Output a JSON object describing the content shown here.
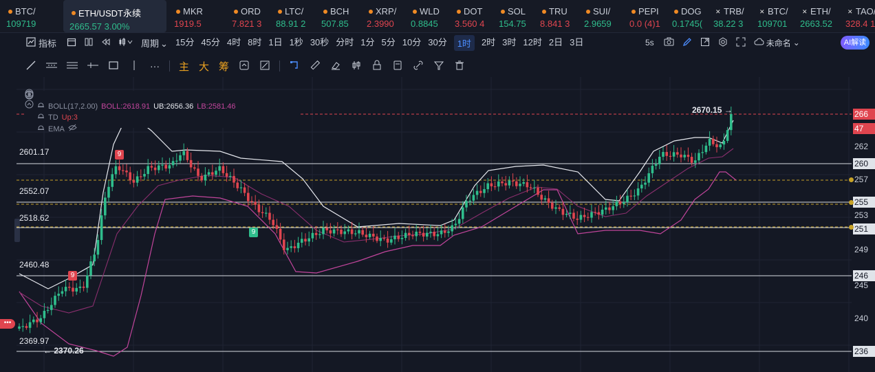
{
  "tickers": [
    {
      "name": "BTC/",
      "price": "109719",
      "change": "",
      "dir": "up",
      "icon": "coin-orange"
    },
    {
      "name": "ETH/USDT永续",
      "price": "2665.57",
      "change": "3.00%",
      "dir": "up",
      "icon": "coin-orange",
      "active": true
    },
    {
      "name": "MKR",
      "price": "1919.5",
      "change": "",
      "dir": "dn",
      "icon": "coin-orange"
    },
    {
      "name": "ORD",
      "price": "7.821",
      "change": "3",
      "dir": "dn",
      "icon": "coin-orange"
    },
    {
      "name": "LTC/",
      "price": "88.91",
      "change": "2",
      "dir": "up",
      "icon": "coin-orange"
    },
    {
      "name": "BCH",
      "price": "507.85",
      "change": "",
      "dir": "up",
      "icon": "coin-orange"
    },
    {
      "name": "XRP/",
      "price": "2.3990",
      "change": "",
      "dir": "dn",
      "icon": "coin-orange"
    },
    {
      "name": "WLD",
      "price": "0.8845",
      "change": "",
      "dir": "up",
      "icon": "coin-orange"
    },
    {
      "name": "DOT",
      "price": "3.560",
      "change": "4",
      "dir": "dn",
      "icon": "coin-orange"
    },
    {
      "name": "SOL",
      "price": "154.75",
      "change": "",
      "dir": "up",
      "icon": "coin-orange"
    },
    {
      "name": "TRU",
      "price": "8.841",
      "change": "3",
      "dir": "dn",
      "icon": "coin-orange"
    },
    {
      "name": "SUI/",
      "price": "2.9659",
      "change": "",
      "dir": "up",
      "icon": "coin-orange"
    },
    {
      "name": "PEPI",
      "price": "0.0",
      "change": "(4)1",
      "dir": "dn",
      "icon": "coin-orange"
    },
    {
      "name": "DOG",
      "price": "0.1745(",
      "change": "",
      "dir": "up",
      "icon": "coin-orange"
    },
    {
      "name": "TRB/",
      "price": "38.22",
      "change": "3",
      "dir": "up",
      "icon": "x"
    },
    {
      "name": "BTC/",
      "price": "109701",
      "change": "",
      "dir": "up",
      "icon": "x"
    },
    {
      "name": "ETH/",
      "price": "2663.52",
      "change": "",
      "dir": "up",
      "icon": "x"
    },
    {
      "name": "TAO/",
      "price": "328.4",
      "change": "1",
      "dir": "dn",
      "icon": "x"
    }
  ],
  "toolbar": {
    "indicators": "指标",
    "period": "周期",
    "intervals": [
      "15分",
      "45分",
      "4时",
      "8时",
      "1日",
      "1秒",
      "30秒",
      "分时",
      "1分",
      "5分",
      "10分",
      "30分",
      "1时",
      "2时",
      "3时",
      "12时",
      "2日",
      "3日"
    ],
    "selected_interval": "1时",
    "seconds": "5s",
    "layout_name": "未命名",
    "ai_label": "AI解读"
  },
  "drawing_tools": {
    "text_tools": [
      "主",
      "大",
      "筹"
    ]
  },
  "legend": {
    "boll_label": "BOLL(17,2.00)",
    "boll_value": "BOLL:2618.91",
    "ub": "UB:2656.36",
    "lb": "LB:2581.46",
    "td_label": "TD",
    "td_value": "Up:3",
    "ema_label": "EMA"
  },
  "levels": [
    {
      "label": "2601.17",
      "axis": "260"
    },
    {
      "label": "2552.07",
      "axis": "255"
    },
    {
      "label": "2518.62",
      "axis": "251"
    },
    {
      "label": "2460.48",
      "axis": "246"
    },
    {
      "label": "2369.97",
      "axis": "236"
    }
  ],
  "price_annotations": {
    "high": "2670.15",
    "low": "2370.26"
  },
  "td_markers": [
    "9",
    "9",
    "9"
  ],
  "axis": {
    "current": "266",
    "countdown": "47",
    "ticks": [
      "262",
      "257",
      "253",
      "249",
      "245",
      "240"
    ]
  },
  "left_pill": "•••",
  "colors": {
    "up": "#2fbd8c",
    "down": "#e0454f",
    "background": "#141824",
    "accent": "#4c8dff",
    "boll_mid": "#c2459c",
    "boll_band": "#ffffff"
  }
}
